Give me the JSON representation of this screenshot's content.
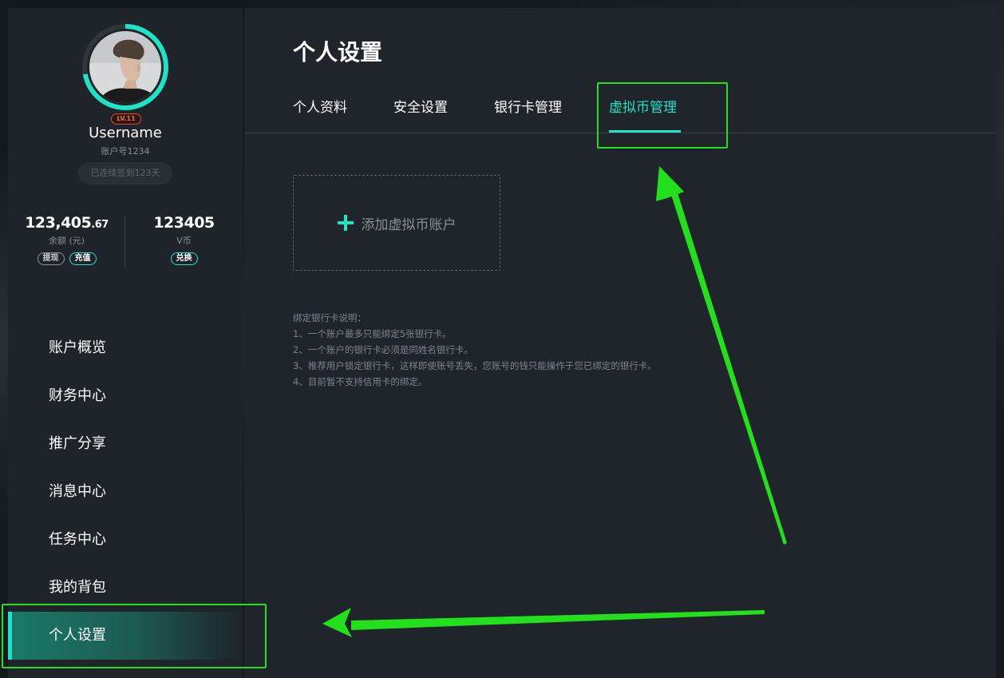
{
  "user": {
    "level": "LV.11",
    "username": "Username",
    "account_no": "账户号1234",
    "signin_streak": "已连续签到123天"
  },
  "balance": {
    "value_int": "123,405",
    "value_dec": ".67",
    "label": "余额 (元)",
    "withdraw": "提现",
    "recharge": "充值"
  },
  "vcoin": {
    "value": "123405",
    "label": "V币",
    "exchange": "兑换"
  },
  "nav": {
    "items": [
      {
        "label": "账户概览"
      },
      {
        "label": "财务中心"
      },
      {
        "label": "推广分享"
      },
      {
        "label": "消息中心"
      },
      {
        "label": "任务中心"
      },
      {
        "label": "我的背包"
      },
      {
        "label": "个人设置"
      }
    ],
    "active_index": 6
  },
  "page": {
    "title": "个人设置",
    "tabs": [
      {
        "label": "个人资料"
      },
      {
        "label": "安全设置"
      },
      {
        "label": "银行卡管理"
      },
      {
        "label": "虚拟币管理"
      }
    ],
    "active_tab_index": 3
  },
  "add_account": {
    "label": "添加虚拟币账户"
  },
  "notes": {
    "heading": "绑定银行卡说明：",
    "lines": [
      "1、一个账户最多只能绑定5张银行卡。",
      "2、一个账户的银行卡必须是同姓名银行卡。",
      "3、推荐用户锁定银行卡，这样即使账号丢失，您账号的钱只能操作于您已绑定的银行卡。",
      "4、目前暂不支持信用卡的绑定。"
    ]
  },
  "colors": {
    "accent": "#1ee3c4",
    "annotation": "#22e01c",
    "background": "#20242b",
    "sidebar": "#1f232a"
  }
}
